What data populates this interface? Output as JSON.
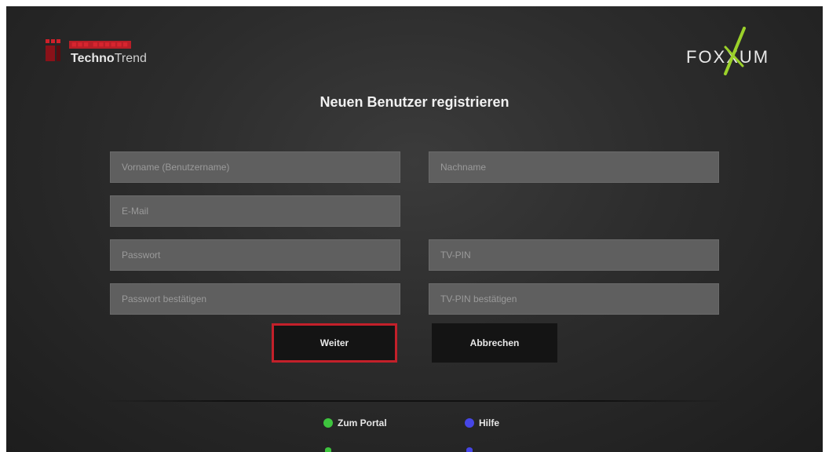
{
  "header": {
    "brand_left_red": "■■■ ■■■■■■",
    "brand_left_bold": "Techno",
    "brand_left_rest": "Trend",
    "brand_right": "FOXXUM",
    "brand_right_color": "#9bd12a"
  },
  "title": "Neuen Benutzer registrieren",
  "form": {
    "first_name_placeholder": "Vorname (Benutzername)",
    "last_name_placeholder": "Nachname",
    "email_placeholder": "E-Mail",
    "password_placeholder": "Passwort",
    "pin_placeholder": "TV-PIN",
    "password_confirm_placeholder": "Passwort bestätigen",
    "pin_confirm_placeholder": "TV-PIN bestätigen"
  },
  "buttons": {
    "next": "Weiter",
    "cancel": "Abbrechen"
  },
  "footer": {
    "portal_label": "Zum Portal",
    "help_label": "Hilfe",
    "green_color": "#3ec43e",
    "blue_color": "#4646e6"
  },
  "colors": {
    "focus_border": "#c3202a",
    "field_bg": "#5f5f5f",
    "button_bg": "#141414"
  }
}
